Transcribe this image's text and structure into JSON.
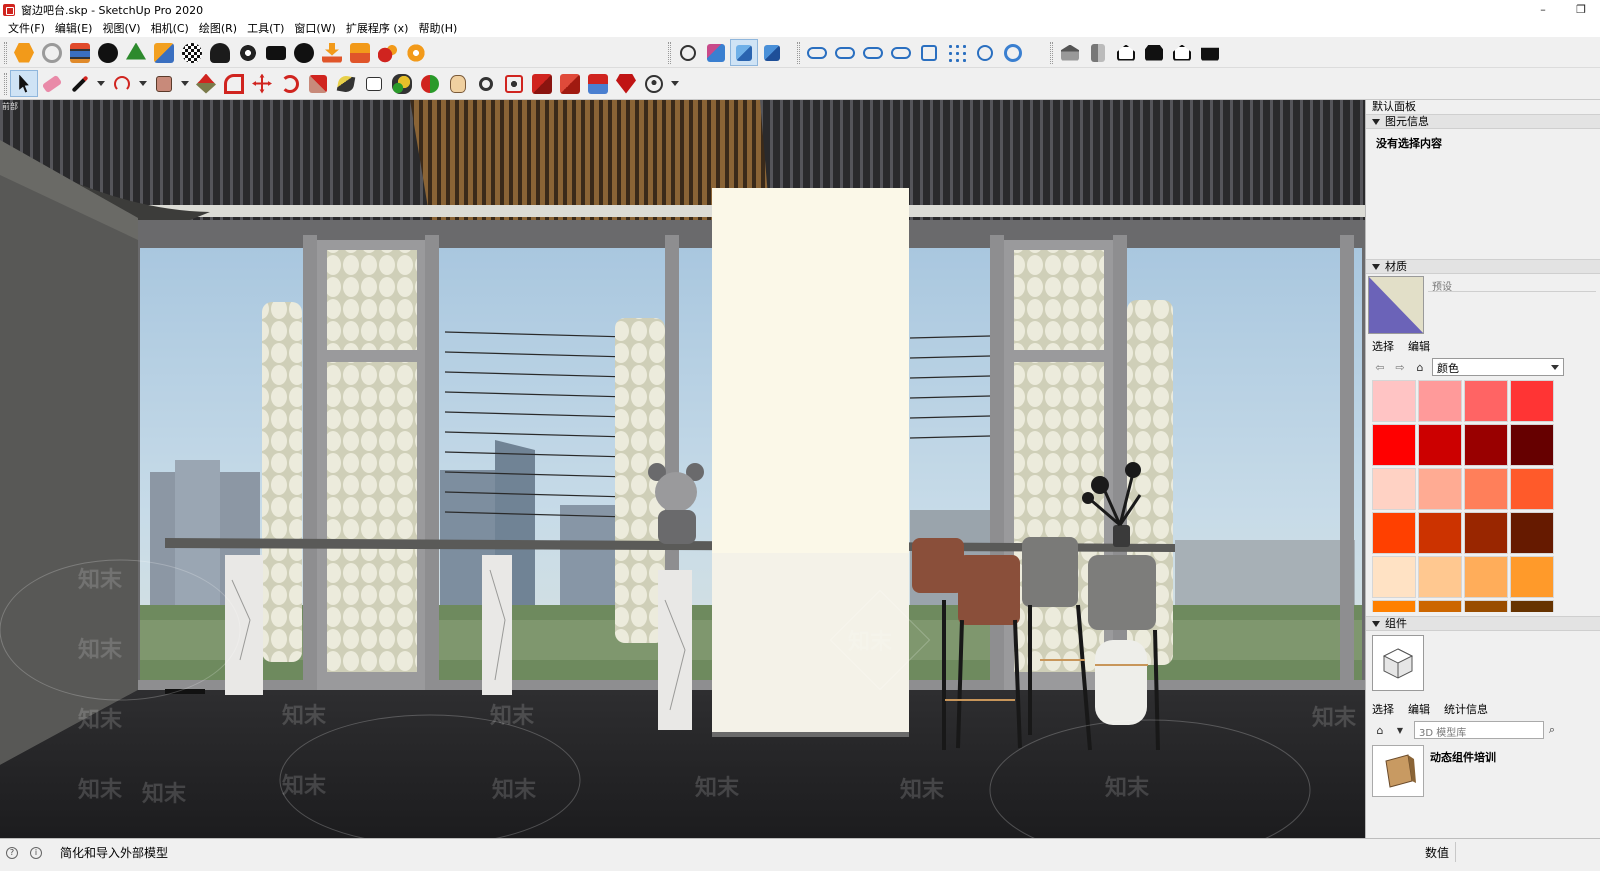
{
  "window": {
    "title": "窗边吧台.skp - SketchUp Pro 2020",
    "min_glyph": "–",
    "restore_glyph": "❐"
  },
  "menu": [
    "文件(F)",
    "编辑(E)",
    "视图(V)",
    "相机(C)",
    "绘图(R)",
    "工具(T)",
    "窗口(W)",
    "扩展程序 (x)",
    "帮助(H)"
  ],
  "viewport": {
    "scene_tag": "前部",
    "watermark_text": "知末",
    "watermarks": [
      "知末",
      "知末",
      "知末",
      "知末",
      "知末",
      "知末",
      "知末",
      "知末",
      "知末",
      "知末",
      "知末",
      "知末",
      "知末",
      "知末"
    ],
    "colors": {
      "ceiling": "#2a2a2c",
      "wood_slats": "#7a5a34",
      "sky": "#b8d2e6",
      "frame": "#8c8c8c",
      "column": "#fbf8e8",
      "floor": "#252527",
      "marble": "#e9e8e6",
      "counter": "#5a5a58",
      "chair_leather": "#8a4f3a"
    }
  },
  "panel": {
    "title": "默认面板",
    "entity_info": {
      "header": "图元信息",
      "empty_text": "没有选择内容"
    },
    "materials": {
      "header": "材质",
      "name_placeholder": "预设",
      "tabs": [
        "选择",
        "编辑"
      ],
      "library": "颜色",
      "swatches": [
        "#ffc4c4",
        "#ff9a9a",
        "#ff6464",
        "#ff3434",
        "#ff0000",
        "#cc0000",
        "#990000",
        "#660000",
        "#ffd2c4",
        "#ffab93",
        "#ff7f5a",
        "#ff5a2a",
        "#ff4000",
        "#cc3300",
        "#992600",
        "#661a00",
        "#ffe2c4",
        "#ffc890",
        "#ffad5a",
        "#ff9a2a",
        "#ff8000",
        "#cc6600",
        "#994d00",
        "#663300"
      ]
    },
    "components": {
      "header": "组件",
      "tabs": [
        "选择",
        "编辑",
        "统计信息"
      ],
      "search_placeholder": "3D 模型库",
      "result_title": "动态组件培训"
    }
  },
  "statusbar": {
    "text": "简化和导入外部模型",
    "measure_label": "数值"
  }
}
